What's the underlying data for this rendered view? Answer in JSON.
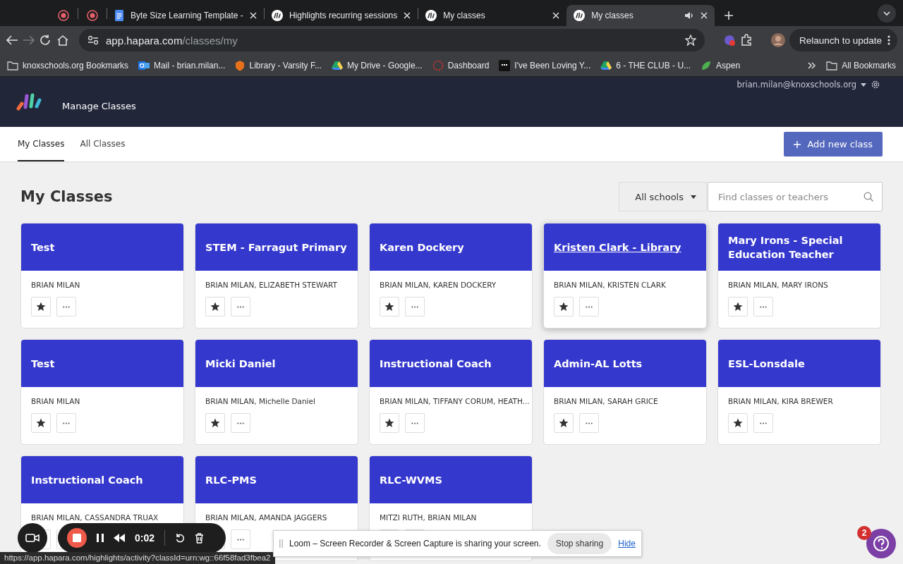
{
  "browser": {
    "tabs": [
      {
        "kind": "recording",
        "selected": false
      },
      {
        "kind": "recording",
        "selected": false
      },
      {
        "kind": "document",
        "title": "Byte Size Learning Template -",
        "selected": false
      },
      {
        "kind": "app",
        "title": "Highlights recurring sessions",
        "selected": false
      },
      {
        "kind": "app",
        "title": "My classes",
        "selected": false
      },
      {
        "kind": "app",
        "title": "My classes",
        "selected": true,
        "audio": true
      }
    ],
    "address": {
      "host": "app.hapara.com",
      "path": "/classes/my"
    },
    "update_button": "Relaunch to update",
    "bookmarks": [
      {
        "kind": "folder",
        "label": "knoxschools.org Bookmarks"
      },
      {
        "kind": "mail",
        "label": "Mail - brian.milan..."
      },
      {
        "kind": "shield",
        "label": "Library - Varsity F..."
      },
      {
        "kind": "drive",
        "label": "My Drive - Google..."
      },
      {
        "kind": "dashboard",
        "label": "Dashboard"
      },
      {
        "kind": "video",
        "label": "I've Been Loving Y..."
      },
      {
        "kind": "drive",
        "label": "6 - THE CLUB - U..."
      },
      {
        "kind": "leaf",
        "label": "Aspen"
      }
    ],
    "all_bookmarks": "All Bookmarks"
  },
  "app": {
    "user": "brian.milan@knoxschools.org",
    "title": "Manage Classes",
    "nav": [
      {
        "label": "My Classes",
        "selected": true
      },
      {
        "label": "All Classes",
        "selected": false
      }
    ],
    "add_button": "Add new class",
    "heading": "My Classes",
    "school_filter": "All schools",
    "search": {
      "placeholder": "Find classes or teachers"
    },
    "cards": [
      {
        "title": "Test",
        "teachers": "BRIAN MILAN",
        "hovered": false
      },
      {
        "title": "STEM - Farragut Primary",
        "teachers": "BRIAN MILAN, ELIZABETH STEWART",
        "hovered": false
      },
      {
        "title": "Karen Dockery",
        "teachers": "BRIAN MILAN, KAREN DOCKERY",
        "hovered": false
      },
      {
        "title": "Kristen Clark - Library",
        "teachers": "BRIAN MILAN, KRISTEN CLARK",
        "hovered": true
      },
      {
        "title": "Mary Irons - Special Education Teacher",
        "teachers": "BRIAN MILAN, MARY IRONS",
        "hovered": false
      },
      {
        "title": "Test",
        "teachers": "BRIAN MILAN",
        "hovered": false
      },
      {
        "title": "Micki Daniel",
        "teachers": "BRIAN MILAN, Michelle Daniel",
        "hovered": false
      },
      {
        "title": "Instructional Coach",
        "teachers": "BRIAN MILAN, TIFFANY CORUM, HEATH...",
        "hovered": false
      },
      {
        "title": "Admin-AL Lotts",
        "teachers": "BRIAN MILAN, SARAH GRICE",
        "hovered": false
      },
      {
        "title": "ESL-Lonsdale",
        "teachers": "BRIAN MILAN, KIRA BREWER",
        "hovered": false
      },
      {
        "title": "Instructional Coach",
        "teachers": "BRIAN MILAN, CASSANDRA TRUAX",
        "hovered": false
      },
      {
        "title": "RLC-PMS",
        "teachers": "BRIAN MILAN, AMANDA JAGGERS",
        "hovered": false
      },
      {
        "title": "RLC-WVMS",
        "teachers": "MITZI RUTH, BRIAN MILAN",
        "hovered": false
      }
    ]
  },
  "recorder": {
    "timer": "0:02"
  },
  "status_url": "https://app.hapara.com/highlights/activity?classId=urn:wg::66f58fad3fbea2",
  "share_bar": {
    "message": "Loom – Screen Recorder & Screen Capture is sharing your screen.",
    "stop_button": "Stop sharing",
    "hide_link": "Hide"
  },
  "help": {
    "badge": "2"
  }
}
